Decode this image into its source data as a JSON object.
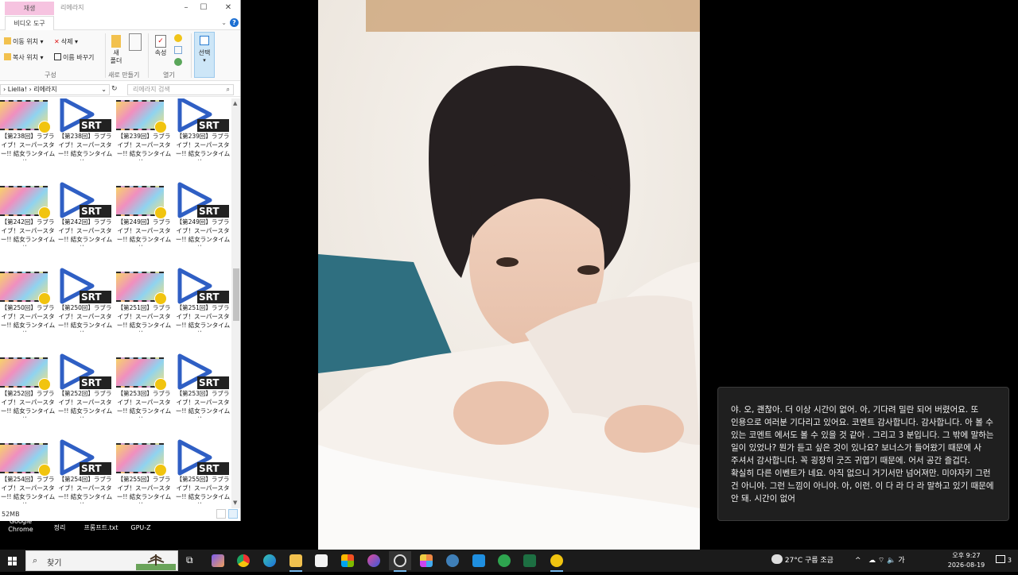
{
  "explorer": {
    "context_tab": "재생",
    "window_title": "리에라지",
    "ribbon_tab": "비디오 도구",
    "ribbon": {
      "move_to": "이동 위치",
      "delete": "삭제",
      "copy_to": "복사 위치",
      "rename": "이름 바꾸기",
      "new_folder": "새\n폴더",
      "properties": "속성",
      "select": "선택",
      "group_organize": "구성",
      "group_new": "새로 만들기",
      "group_open": "열기"
    },
    "address": {
      "part1": "Liella!",
      "part2": "리에라지"
    },
    "search_placeholder": "리에라지 검색",
    "files": [
      {
        "name": "【第238回】ラブライブ！スーパースター!! 結女ランタイム放..."
      },
      {
        "name": "【第238回】ラブライブ！スーパースター!! 結女ランタイム放..."
      },
      {
        "name": "【第239回】ラブライブ！スーパースター!! 結女ランタイム放..."
      },
      {
        "name": "【第239回】ラブライブ！スーパースター!! 結女ランタイム放..."
      },
      {
        "name": "【第242回】ラブライブ！スーパースター!! 結女ランタイム放..."
      },
      {
        "name": "【第242回】ラブライブ！スーパースター!! 結女ランタイム放..."
      },
      {
        "name": "【第249回】ラブライブ！スーパースター!! 結女ランタイム放..."
      },
      {
        "name": "【第249回】ラブライブ！スーパースター!! 結女ランタイム放..."
      },
      {
        "name": "【第250回】ラブライブ！スーパースター!! 結女ランタイム放..."
      },
      {
        "name": "【第250回】ラブライブ！スーパースター!! 結女ランタイム放..."
      },
      {
        "name": "【第251回】ラブライブ！スーパースター!! 結女ランタイム放..."
      },
      {
        "name": "【第251回】ラブライブ！スーパースター!! 結女ランタイム放..."
      },
      {
        "name": "【第252回】ラブライブ！スーパースター!! 結女ランタイム放..."
      },
      {
        "name": "【第252回】ラブライブ！スーパースター!! 結女ランタイム放..."
      },
      {
        "name": "【第253回】ラブライブ！スーパースター!! 結女ランタイム放..."
      },
      {
        "name": "【第253回】ラブライブ！スーパースター!! 結女ランタイム放..."
      },
      {
        "name": "【第254回】ラブライブ！スーパースター!! 結女ランタイム放..."
      },
      {
        "name": "【第254回】ラブライブ！スーパースター!! 結女ランタイム放..."
      },
      {
        "name": "【第255回】ラブライブ！スーパースター!! 結女ランタイム放..."
      },
      {
        "name": "【第255回】ラブライブ！スーパースター!! 結女ランタイム放..."
      }
    ],
    "srt_label": "SRT",
    "status_size": "52MB"
  },
  "desktop_icons": [
    {
      "label": "Google\nChrome"
    },
    {
      "label": "정리"
    },
    {
      "label": "프롬프트.txt"
    },
    {
      "label": "GPU-Z"
    }
  ],
  "caption": "야. 오, 괜찮아. 더 이상 시간이 없어. 아, 기다려 밀란 되어 버렸어요. 또 인용으로 여러분 기다리고 있어요. 코멘트 감사합니다. 감사합니다. 아 볼 수 있는 코멘트 에서도 볼 수 있을 것 같아 . 그리고 3 분입니다. 그 밖에 말하는 일이 있었나? 뭔가 듣고 싶은 것이 있나요? 보너스가 들어왔기 때문에 사 주셔서 감사합니다. 꼭 굉장히 굿즈 귀엽기 때문에. 어서 공간 즐겁다. 확실히 다른 이벤트가 네요. 아직 없으니 거기서만 넘어져만. 미야자키 그런 건 아니야. 그런 느낌이 아니야. 아, 이런. 이 다 라 다 라 말하고 있기 때문에 안 돼. 시간이 없어",
  "taskbar": {
    "search_label": "찾기",
    "weather": "27°C 구름 조금",
    "time": "오후 9:27",
    "date": "2026-08-19",
    "notification_count": "3"
  }
}
